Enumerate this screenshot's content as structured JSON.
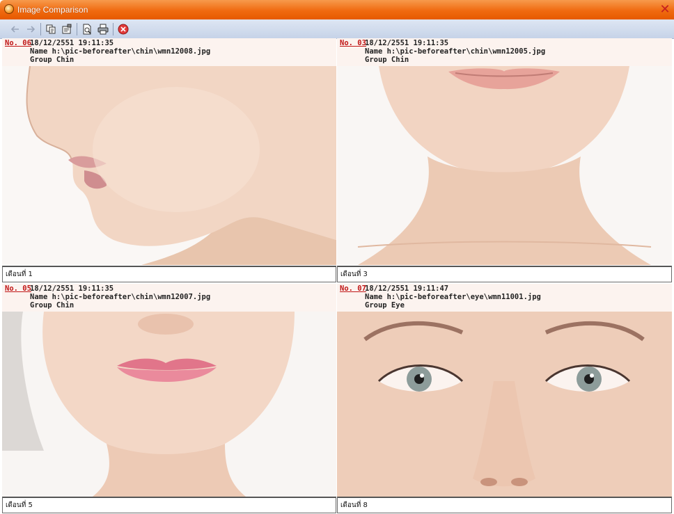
{
  "window": {
    "title": "Image Comparison",
    "close_glyph": "✕"
  },
  "toolbar": {
    "items": [
      {
        "name": "back-arrow-icon"
      },
      {
        "name": "forward-arrow-icon"
      },
      {
        "name": "copy-icon"
      },
      {
        "name": "properties-icon"
      },
      {
        "name": "print-preview-icon"
      },
      {
        "name": "print-icon"
      },
      {
        "name": "close-circle-icon"
      }
    ]
  },
  "panels": [
    {
      "no": "No. 06",
      "datetime": "18/12/2551 19:11:35",
      "name": "Name h:\\pic-beforeafter\\chin\\wmn12008.jpg",
      "group": "Group Chin",
      "caption": "เดือนที่ 1"
    },
    {
      "no": "No. 03",
      "datetime": "18/12/2551 19:11:35",
      "name": "Name h:\\pic-beforeafter\\chin\\wmn12005.jpg",
      "group": "Group Chin",
      "caption": "เดือนที่ 3"
    },
    {
      "no": "No. 05",
      "datetime": "18/12/2551 19:11:35",
      "name": "Name h:\\pic-beforeafter\\chin\\wmn12007.jpg",
      "group": "Group Chin",
      "caption": "เดือนที่ 5"
    },
    {
      "no": "No. 07",
      "datetime": "18/12/2551 19:11:47",
      "name": "Name h:\\pic-beforeafter\\eye\\wmn11001.jpg",
      "group": "Group Eye",
      "caption": "เดือนที่ 8"
    }
  ],
  "colors": {
    "title_orange": "#f06a10",
    "link_red": "#c01616",
    "header_bg": "#fcf3ef",
    "skin": "#f3d9c9"
  }
}
